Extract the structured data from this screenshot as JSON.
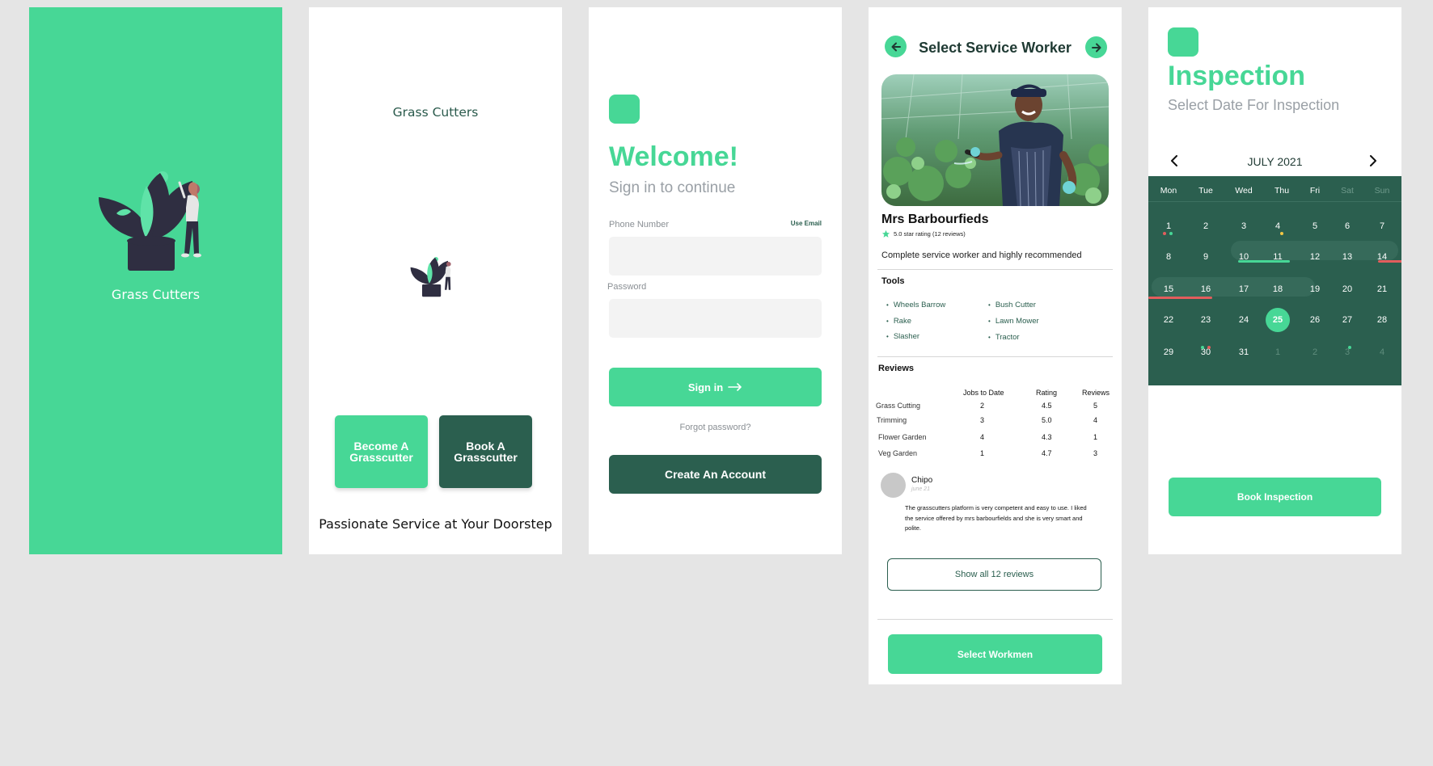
{
  "screens": {
    "s1": {
      "title": "Grass Cutters"
    },
    "s2": {
      "title": "Grass Cutters",
      "become_label": "Become  A Grasscutter",
      "book_label": "Book  A Grasscutter",
      "tagline": "Passionate  Service at Your Doorstep"
    },
    "s3": {
      "welcome": "Welcome!",
      "subtitle": "Sign in to continue",
      "phone_label": "Phone Number",
      "use_email": "Use Email",
      "phone_value": "",
      "password_label": "Password",
      "password_value": "",
      "signin_label": "Sign in",
      "forgot": "Forgot password?",
      "create_label": "Create  An Account"
    },
    "s4": {
      "header": "Select Service Worker",
      "name": "Mrs Barbourfieds",
      "rating_text": "5.0 star rating (12 reviews)",
      "description": "Complete service worker and highly recommended",
      "tools_title": "Tools",
      "tools": [
        "Wheels Barrow",
        "Rake",
        "Slasher",
        "Bush Cutter",
        "Lawn Mower",
        "Tractor"
      ],
      "reviews_title": "Reviews",
      "review_table": {
        "headers": [
          "Jobs to Date",
          "Rating",
          "Reviews"
        ],
        "rows": [
          {
            "label": "Grass Cutting",
            "jobs": "2",
            "rating": "4.5",
            "reviews": "5"
          },
          {
            "label": "Trimming",
            "jobs": "3",
            "rating": "5.0",
            "reviews": "4"
          },
          {
            "label": "Flower Garden",
            "jobs": "4",
            "rating": "4.3",
            "reviews": "1"
          },
          {
            "label": "Veg Garden",
            "jobs": "1",
            "rating": "4.7",
            "reviews": "3"
          }
        ]
      },
      "review": {
        "name": "Chipo",
        "date": "june 21",
        "text": "The grasscutters platform is very competent and easy to use. I liked the service offered by mrs barbourfields and she is very smart and polite."
      },
      "show_all_label": "Show all 12 reviews",
      "select_label": "Select Workmen"
    },
    "s5": {
      "title": "Inspection",
      "subtitle": "Select Date For  Inspection",
      "month": "JULY 2021",
      "weekdays": [
        "Mon",
        "Tue",
        "Wed",
        "Thu",
        "Fri",
        "Sat",
        "Sun"
      ],
      "weeks": [
        [
          "1",
          "2",
          "3",
          "4",
          "5",
          "6",
          "7"
        ],
        [
          "8",
          "9",
          "10",
          "11",
          "12",
          "13",
          "14"
        ],
        [
          "15",
          "16",
          "17",
          "18",
          "19",
          "20",
          "21"
        ],
        [
          "22",
          "23",
          "24",
          "25",
          "26",
          "27",
          "28"
        ],
        [
          "29",
          "30",
          "31",
          "1",
          "2",
          "3",
          "4"
        ]
      ],
      "selected_day": "25",
      "book_label": "Book Inspection"
    }
  },
  "colors": {
    "accent": "#47d796",
    "dark": "#2b5f4f",
    "red": "#e35d5d",
    "yellow": "#f2c744"
  }
}
